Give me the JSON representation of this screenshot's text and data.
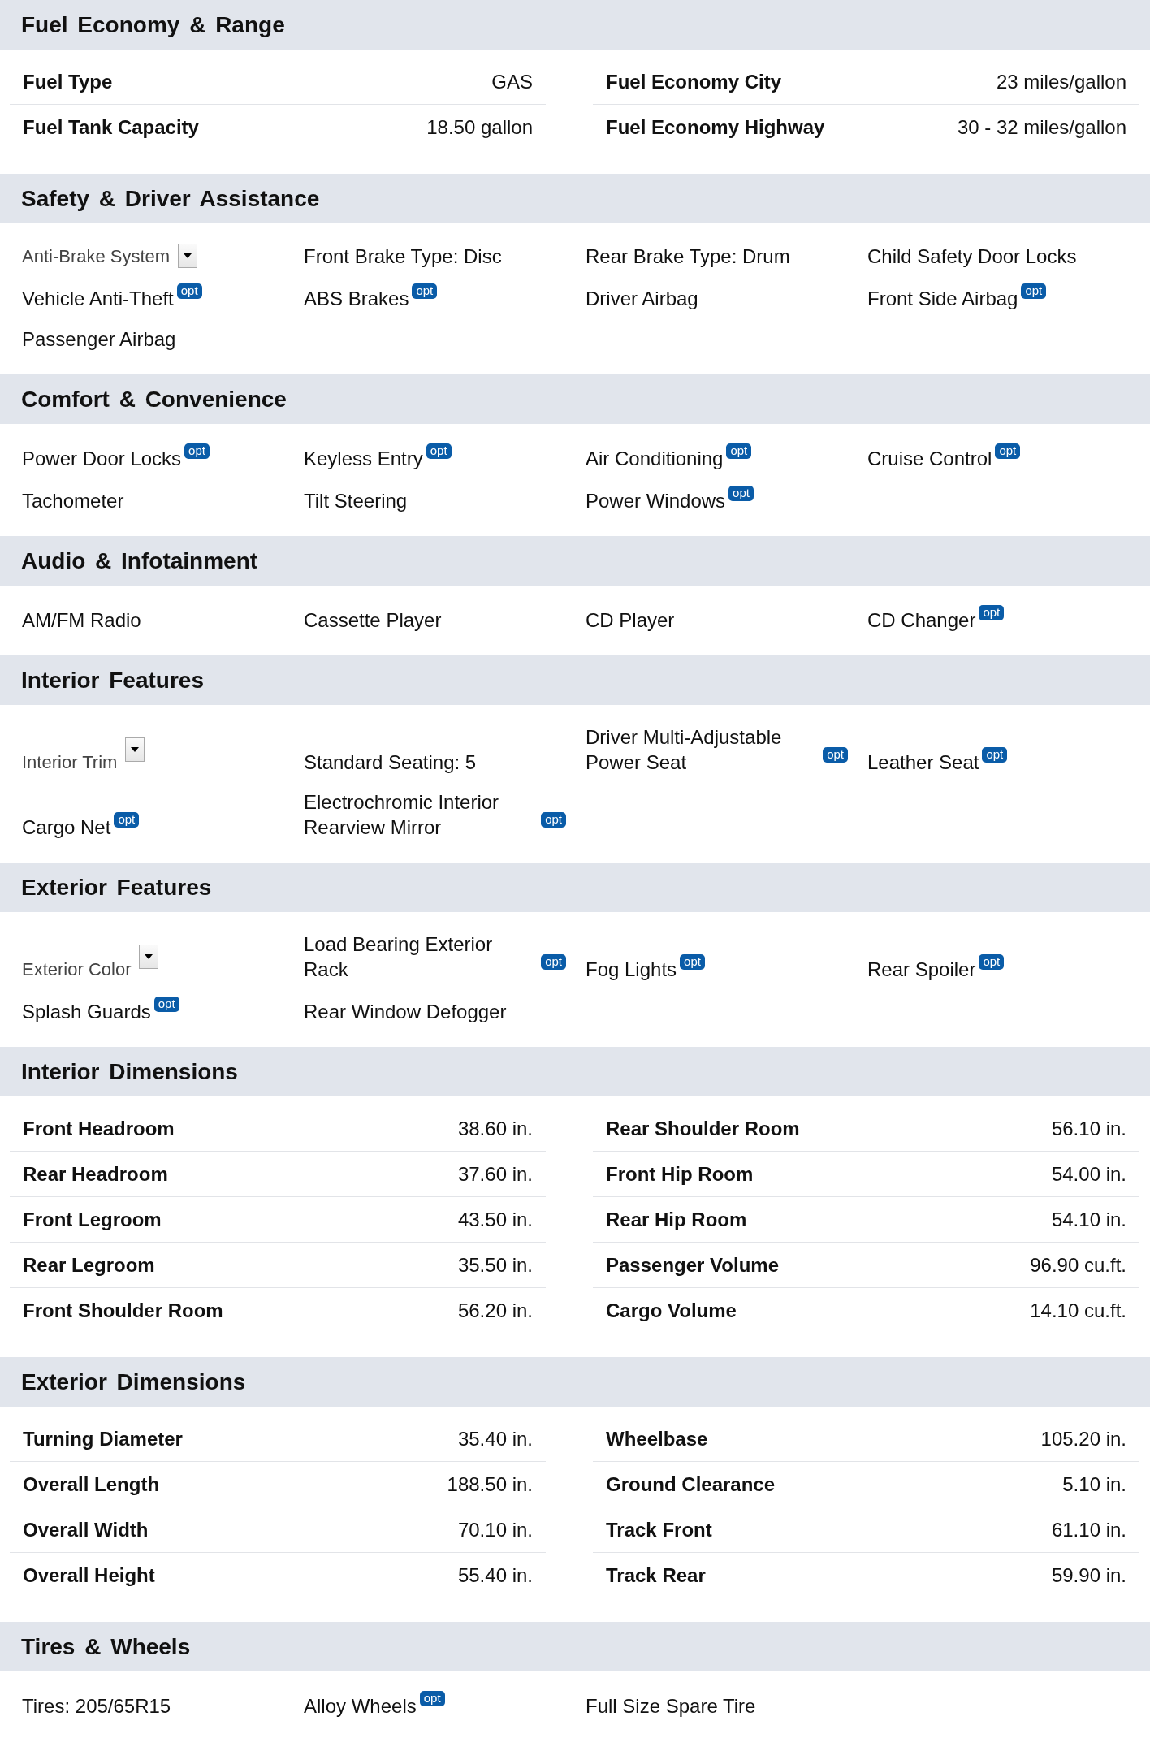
{
  "sections": [
    {
      "title": "Fuel Economy & Range",
      "kind": "specs",
      "columns": [
        [
          {
            "label": "Fuel Type",
            "value": "GAS"
          },
          {
            "label": "Fuel Tank Capacity",
            "value": "18.50 gallon"
          }
        ],
        [
          {
            "label": "Fuel Economy City",
            "value": "23 miles/gallon"
          },
          {
            "label": "Fuel Economy Highway",
            "value": "30 - 32 miles/gallon"
          }
        ]
      ]
    },
    {
      "title": "Safety & Driver Assistance",
      "kind": "features",
      "items": [
        {
          "text": "Anti-Brake System",
          "kind": "dropdown"
        },
        {
          "text": "Front Brake Type: Disc",
          "kind": "text"
        },
        {
          "text": "Rear Brake Type: Drum",
          "kind": "text"
        },
        {
          "text": "Child Safety Door Locks",
          "kind": "text"
        },
        {
          "text": "Vehicle Anti-Theft",
          "kind": "text",
          "badge": "opt"
        },
        {
          "text": "ABS Brakes",
          "kind": "text",
          "badge": "opt"
        },
        {
          "text": "Driver Airbag",
          "kind": "text"
        },
        {
          "text": "Front Side Airbag",
          "kind": "text",
          "badge": "opt"
        },
        {
          "text": "Passenger Airbag",
          "kind": "text"
        }
      ]
    },
    {
      "title": "Comfort & Convenience",
      "kind": "features",
      "items": [
        {
          "text": "Power Door Locks",
          "kind": "text",
          "badge": "opt"
        },
        {
          "text": "Keyless Entry",
          "kind": "text",
          "badge": "opt"
        },
        {
          "text": "Air Conditioning",
          "kind": "text",
          "badge": "opt"
        },
        {
          "text": "Cruise Control",
          "kind": "text",
          "badge": "opt"
        },
        {
          "text": "Tachometer",
          "kind": "text"
        },
        {
          "text": "Tilt Steering",
          "kind": "text"
        },
        {
          "text": "Power Windows",
          "kind": "text",
          "badge": "opt"
        }
      ]
    },
    {
      "title": "Audio & Infotainment",
      "kind": "features",
      "items": [
        {
          "text": "AM/FM Radio",
          "kind": "text"
        },
        {
          "text": "Cassette Player",
          "kind": "text"
        },
        {
          "text": "CD Player",
          "kind": "text"
        },
        {
          "text": "CD Changer",
          "kind": "text",
          "badge": "opt"
        }
      ]
    },
    {
      "title": "Interior Features",
      "kind": "features",
      "items": [
        {
          "text": "Interior Trim",
          "kind": "dropdown"
        },
        {
          "text": "Standard Seating: 5",
          "kind": "text"
        },
        {
          "text": "Driver Multi-Adjustable Power Seat",
          "kind": "text",
          "badge": "opt"
        },
        {
          "text": "Leather Seat",
          "kind": "text",
          "badge": "opt"
        },
        {
          "text": "Cargo Net",
          "kind": "text",
          "badge": "opt"
        },
        {
          "text": "Electrochromic Interior Rearview Mirror",
          "kind": "text",
          "badge": "opt"
        }
      ]
    },
    {
      "title": "Exterior Features",
      "kind": "features",
      "items": [
        {
          "text": "Exterior Color",
          "kind": "dropdown"
        },
        {
          "text": "Load Bearing Exterior Rack",
          "kind": "text",
          "badge": "opt"
        },
        {
          "text": "Fog Lights",
          "kind": "text",
          "badge": "opt"
        },
        {
          "text": "Rear Spoiler",
          "kind": "text",
          "badge": "opt"
        },
        {
          "text": "Splash Guards",
          "kind": "text",
          "badge": "opt"
        },
        {
          "text": "Rear Window Defogger",
          "kind": "text"
        }
      ]
    },
    {
      "title": "Interior Dimensions",
      "kind": "specs",
      "columns": [
        [
          {
            "label": "Front Headroom",
            "value": "38.60 in."
          },
          {
            "label": "Rear Headroom",
            "value": "37.60 in."
          },
          {
            "label": "Front Legroom",
            "value": "43.50 in."
          },
          {
            "label": "Rear Legroom",
            "value": "35.50 in."
          },
          {
            "label": "Front Shoulder Room",
            "value": "56.20 in."
          }
        ],
        [
          {
            "label": "Rear Shoulder Room",
            "value": "56.10 in."
          },
          {
            "label": "Front Hip Room",
            "value": "54.00 in."
          },
          {
            "label": "Rear Hip Room",
            "value": "54.10 in."
          },
          {
            "label": "Passenger Volume",
            "value": "96.90 cu.ft."
          },
          {
            "label": "Cargo Volume",
            "value": "14.10 cu.ft."
          }
        ]
      ]
    },
    {
      "title": "Exterior Dimensions",
      "kind": "specs",
      "columns": [
        [
          {
            "label": "Turning Diameter",
            "value": "35.40 in."
          },
          {
            "label": "Overall Length",
            "value": "188.50 in."
          },
          {
            "label": "Overall Width",
            "value": "70.10 in."
          },
          {
            "label": "Overall Height",
            "value": "55.40 in."
          }
        ],
        [
          {
            "label": "Wheelbase",
            "value": "105.20 in."
          },
          {
            "label": "Ground Clearance",
            "value": "5.10 in."
          },
          {
            "label": "Track Front",
            "value": "61.10 in."
          },
          {
            "label": "Track Rear",
            "value": "59.90 in."
          }
        ]
      ]
    },
    {
      "title": "Tires & Wheels",
      "kind": "features",
      "items": [
        {
          "text": "Tires: 205/65R15",
          "kind": "text"
        },
        {
          "text": "Alloy Wheels",
          "kind": "text",
          "badge": "opt"
        },
        {
          "text": "Full Size Spare Tire",
          "kind": "text"
        }
      ]
    }
  ]
}
